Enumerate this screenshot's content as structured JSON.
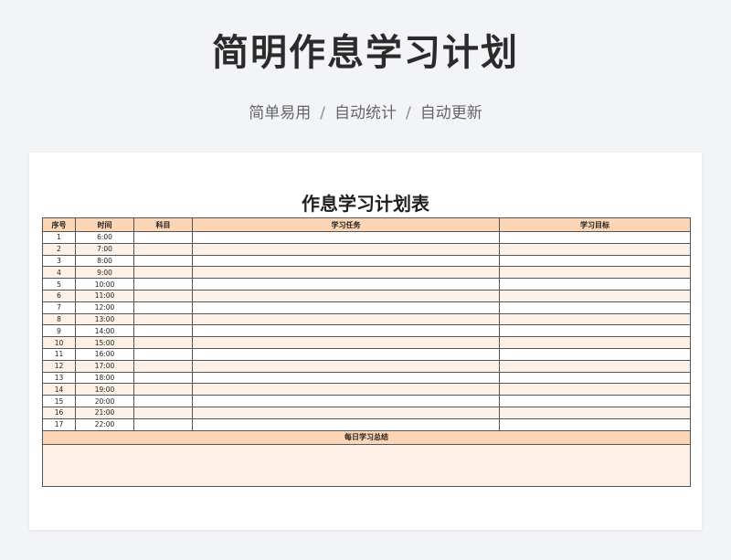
{
  "header": {
    "title": "简明作息学习计划",
    "subtitle_parts": [
      "简单易用",
      "自动统计",
      "自动更新"
    ],
    "separator": "/"
  },
  "sheet": {
    "title": "作息学习计划表",
    "columns": [
      "序号",
      "时间",
      "科目",
      "学习任务",
      "学习目标"
    ],
    "rows": [
      {
        "no": "1",
        "time": "6:00"
      },
      {
        "no": "2",
        "time": "7:00"
      },
      {
        "no": "3",
        "time": "8:00"
      },
      {
        "no": "4",
        "time": "9:00"
      },
      {
        "no": "5",
        "time": "10:00"
      },
      {
        "no": "6",
        "time": "11:00"
      },
      {
        "no": "7",
        "time": "12:00"
      },
      {
        "no": "8",
        "time": "13:00"
      },
      {
        "no": "9",
        "time": "14:00"
      },
      {
        "no": "10",
        "time": "15:00"
      },
      {
        "no": "11",
        "time": "16:00"
      },
      {
        "no": "12",
        "time": "17:00"
      },
      {
        "no": "13",
        "time": "18:00"
      },
      {
        "no": "14",
        "time": "19:00"
      },
      {
        "no": "15",
        "time": "20:00"
      },
      {
        "no": "16",
        "time": "21:00"
      },
      {
        "no": "17",
        "time": "22:00"
      }
    ],
    "summary_label": "每日学习总结"
  },
  "colors": {
    "header_fill": "#fbd5b4",
    "stripe_fill": "#fdf0e6",
    "background": "#f2f4f7"
  }
}
